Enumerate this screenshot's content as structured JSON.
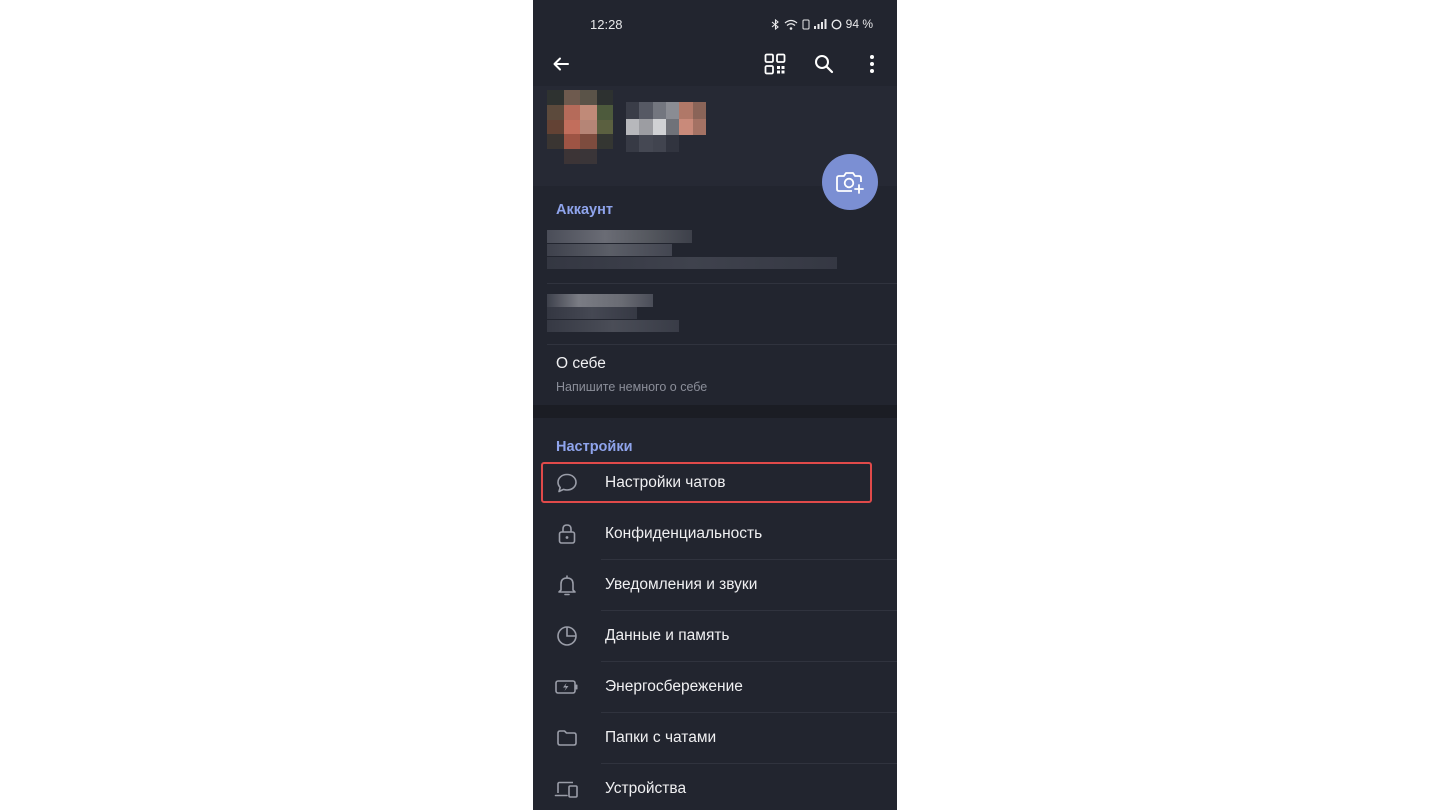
{
  "status_bar": {
    "time": "12:28",
    "battery": "94 %"
  },
  "toolbar": {
    "back_icon": "arrow-left-icon",
    "qr_icon": "qr-code-icon",
    "search_icon": "search-icon",
    "more_icon": "more-vertical-icon"
  },
  "account": {
    "section_title": "Аккаунт",
    "about_title": "О себе",
    "about_placeholder": "Напишите немного о себе"
  },
  "settings": {
    "section_title": "Настройки",
    "items": [
      {
        "label": "Настройки чатов",
        "icon": "chat-bubble-icon"
      },
      {
        "label": "Конфиденциальность",
        "icon": "lock-icon"
      },
      {
        "label": "Уведомления и звуки",
        "icon": "bell-icon"
      },
      {
        "label": "Данные и память",
        "icon": "pie-chart-icon"
      },
      {
        "label": "Энергосбережение",
        "icon": "battery-charging-icon"
      },
      {
        "label": "Папки с чатами",
        "icon": "folder-icon"
      },
      {
        "label": "Устройства",
        "icon": "devices-icon"
      }
    ]
  },
  "colors": {
    "background": "#22252f",
    "accent": "#8fa4ec",
    "fab": "#7b8fd3",
    "highlight": "#e04a4a"
  }
}
